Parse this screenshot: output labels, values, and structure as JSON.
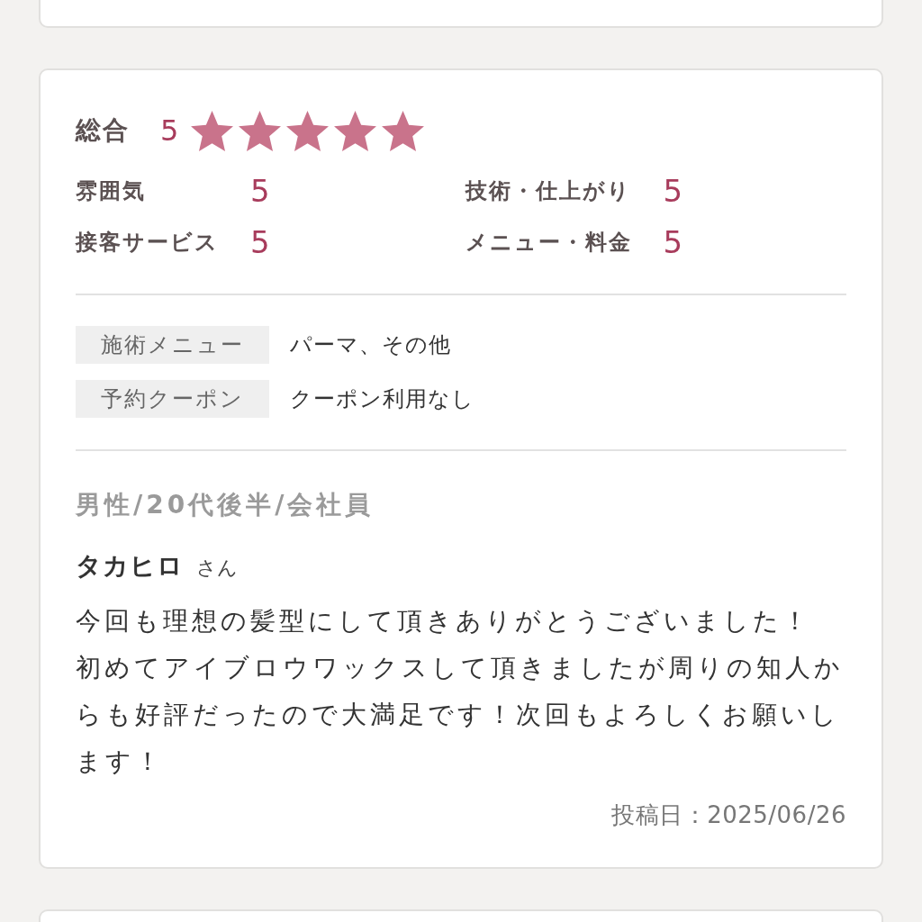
{
  "review": {
    "overall": {
      "label": "総合",
      "score": "5",
      "stars": 5
    },
    "ratings": [
      {
        "label": "雰囲気",
        "score": "5"
      },
      {
        "label": "技術・仕上がり",
        "score": "5"
      },
      {
        "label": "接客サービス",
        "score": "5"
      },
      {
        "label": "メニュー・料金",
        "score": "5"
      }
    ],
    "details": [
      {
        "label": "施術メニュー",
        "value": "パーマ、その他"
      },
      {
        "label": "予約クーポン",
        "value": "クーポン利用なし"
      }
    ],
    "reviewer_profile": "男性/20代後半/会社員",
    "reviewer_name": "タカヒロ",
    "honorific": "さん",
    "body": [
      "今回も理想の髪型にして頂きありがとうございました！",
      "初めてアイブロウワックスして頂きましたが周りの知人からも好評だったので大満足です！次回もよろしくお願いします！"
    ],
    "posted_date": "投稿日：2025/06/26"
  }
}
